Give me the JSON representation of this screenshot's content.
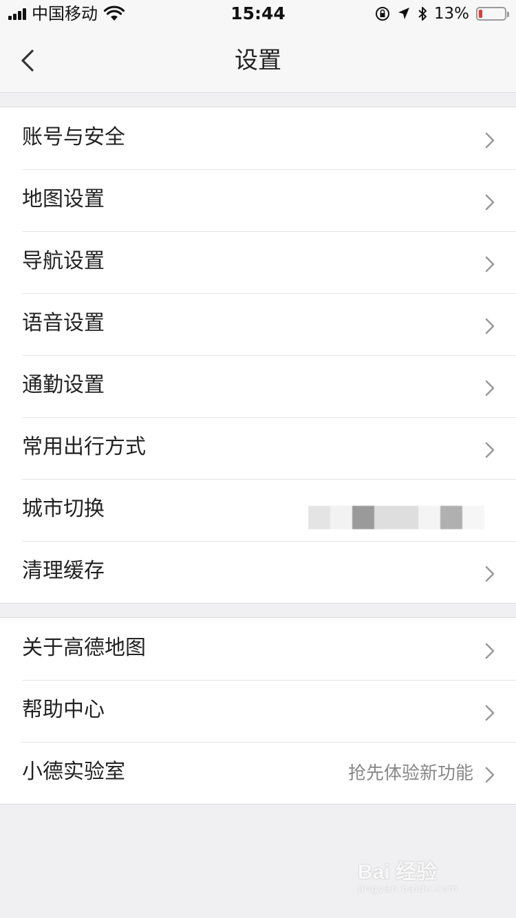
{
  "status_bar": {
    "carrier": "中国移动",
    "time": "15:44",
    "battery_percent_text": "13%",
    "battery_level": 0.13,
    "battery_color": "#e53935"
  },
  "nav": {
    "title": "设置",
    "back_icon": "chevron-left-icon"
  },
  "sections": [
    {
      "items": [
        {
          "label": "账号与安全"
        },
        {
          "label": "地图设置"
        },
        {
          "label": "导航设置"
        },
        {
          "label": "语音设置"
        },
        {
          "label": "通勤设置"
        },
        {
          "label": "常用出行方式"
        },
        {
          "label": "城市切换"
        },
        {
          "label": "清理缓存"
        }
      ]
    },
    {
      "items": [
        {
          "label": "关于高德地图"
        },
        {
          "label": "帮助中心"
        },
        {
          "label": "小德实验室",
          "value": "抢先体验新功能"
        }
      ]
    }
  ],
  "watermark": {
    "brand": "Bai 经验",
    "site": "jingyan.baidu.com"
  }
}
